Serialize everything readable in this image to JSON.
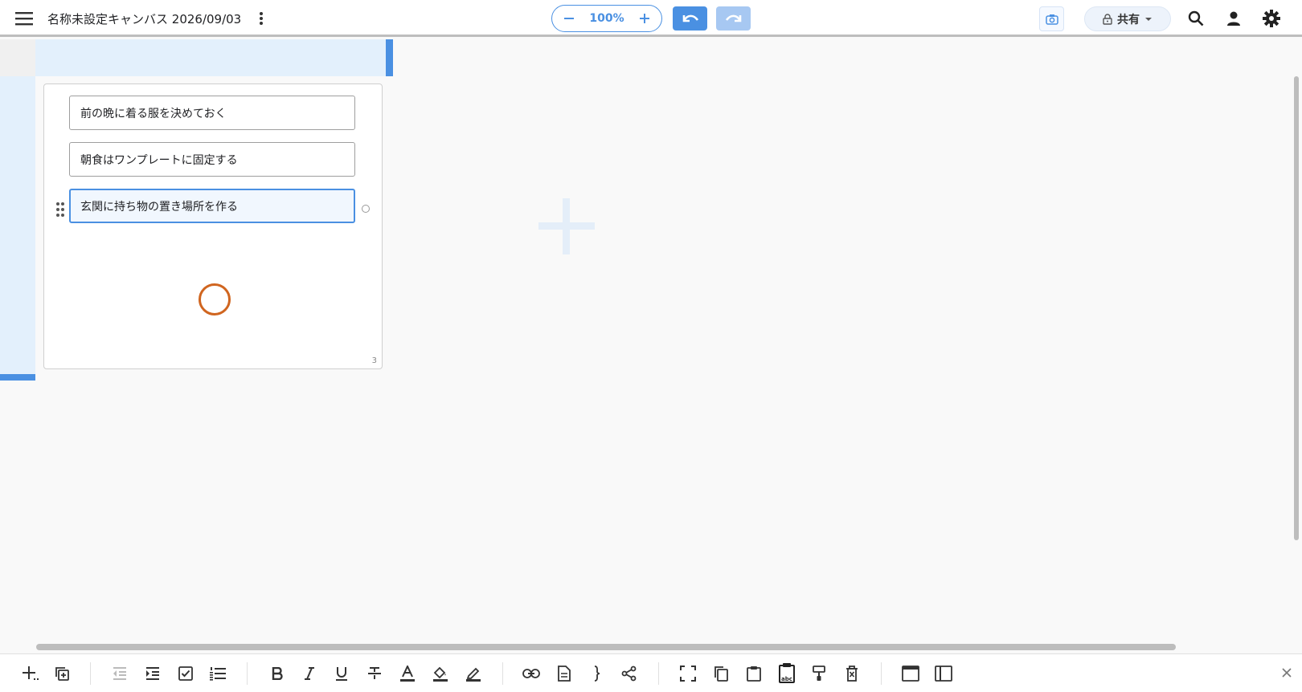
{
  "header": {
    "title": "名称未設定キャンバス 2026/09/03",
    "zoom": "100%",
    "share_label": "共有"
  },
  "card": {
    "items": [
      {
        "label": "前の晩に着る服を決めておく"
      },
      {
        "label": "朝食はワンプレートに固定する"
      },
      {
        "label": "玄関に持ち物の置き場所を作る"
      }
    ],
    "count": "3"
  },
  "colors": {
    "accent": "#4a90e2",
    "accent_light": "#a7c8f2",
    "band": "#e3f0fc",
    "cursor": "#d0651f"
  },
  "icons": {
    "topbar": [
      "menu-icon",
      "more-vert-icon",
      "minus-icon",
      "plus-icon",
      "undo-icon",
      "redo-icon",
      "camera-icon",
      "lock-icon",
      "caret-down-icon",
      "search-icon",
      "person-icon",
      "gear-icon"
    ],
    "bottombar": [
      "add-icon",
      "duplicate-icon",
      "outdent-icon",
      "indent-icon",
      "checkbox-icon",
      "numbered-list-icon",
      "bold-icon",
      "italic-icon",
      "underline-icon",
      "strikethrough-icon",
      "text-color-icon",
      "fill-color-icon",
      "highlight-pen-icon",
      "link-icon",
      "document-icon",
      "brace-icon",
      "share-node-icon",
      "fit-screen-icon",
      "copy-icon",
      "clipboard-icon",
      "paste-text-icon",
      "format-paint-icon",
      "clear-delete-icon",
      "window-icon",
      "sidebar-icon",
      "close-icon"
    ]
  }
}
